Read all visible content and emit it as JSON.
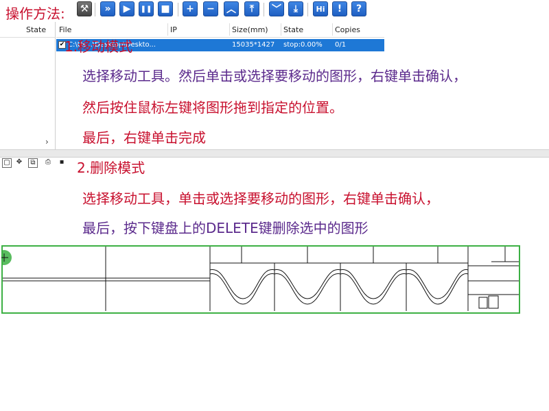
{
  "overlay": {
    "method_title": "操作方法:",
    "mode1_title": "1.移动模式",
    "mode1_line1": "选择移动工具。然后单击或选择要移动的图形，右键单击确认，",
    "mode1_line2": "然后按住鼠标左键将图形拖到指定的位置。",
    "mode1_line3": "最后，右键单击完成",
    "mode2_title": "2.删除模式",
    "mode2_line1": "选择移动工具，单击或选择要移动的图形，右键单击确认，",
    "mode2_line2": "最后，按下键盘上的DELETE键删除选中的图形"
  },
  "toolbar": {
    "icons": [
      {
        "name": "tools-icon",
        "glyph": "⚒"
      },
      {
        "name": "fast-forward-icon",
        "glyph": "»"
      },
      {
        "name": "play-icon",
        "glyph": "▶"
      },
      {
        "name": "pause-icon",
        "glyph": "❚❚"
      },
      {
        "name": "stop-icon",
        "glyph": "■"
      },
      {
        "name": "plus-icon",
        "glyph": "+"
      },
      {
        "name": "minus-icon",
        "glyph": "−"
      },
      {
        "name": "up-icon",
        "glyph": "︿"
      },
      {
        "name": "top-icon",
        "glyph": "⤒"
      },
      {
        "name": "down-icon",
        "glyph": "﹀"
      },
      {
        "name": "bottom-icon",
        "glyph": "⤓"
      },
      {
        "name": "hi-icon",
        "glyph": "Hi"
      },
      {
        "name": "alert-icon",
        "glyph": "!"
      },
      {
        "name": "help-icon",
        "glyph": "?"
      }
    ]
  },
  "left_panel": {
    "state_header": "State",
    "scroll_arrow": "›"
  },
  "table": {
    "headers": [
      "File",
      "IP",
      "Size(mm)",
      "State",
      "Copies"
    ],
    "rows": [
      {
        "file": "C:\\Us...\\Desktop\\Deskto...",
        "ip": "",
        "size": "15035*1427",
        "state": "stop:0.00%",
        "copies": "0/1",
        "checked": "✔"
      }
    ]
  },
  "small_toolbar": {
    "icons": [
      {
        "name": "select-icon",
        "glyph": "▢"
      },
      {
        "name": "move-icon",
        "glyph": "✥"
      },
      {
        "name": "copy-icon",
        "glyph": "⧉"
      },
      {
        "name": "preview-icon",
        "glyph": "⎙"
      },
      {
        "name": "save-icon",
        "glyph": "▪"
      }
    ]
  },
  "colors": {
    "accent_blue": "#1e78d6",
    "instruction_red": "#c8102e",
    "instruction_purple": "#5b2a8c",
    "selection_green": "#3cb043"
  }
}
